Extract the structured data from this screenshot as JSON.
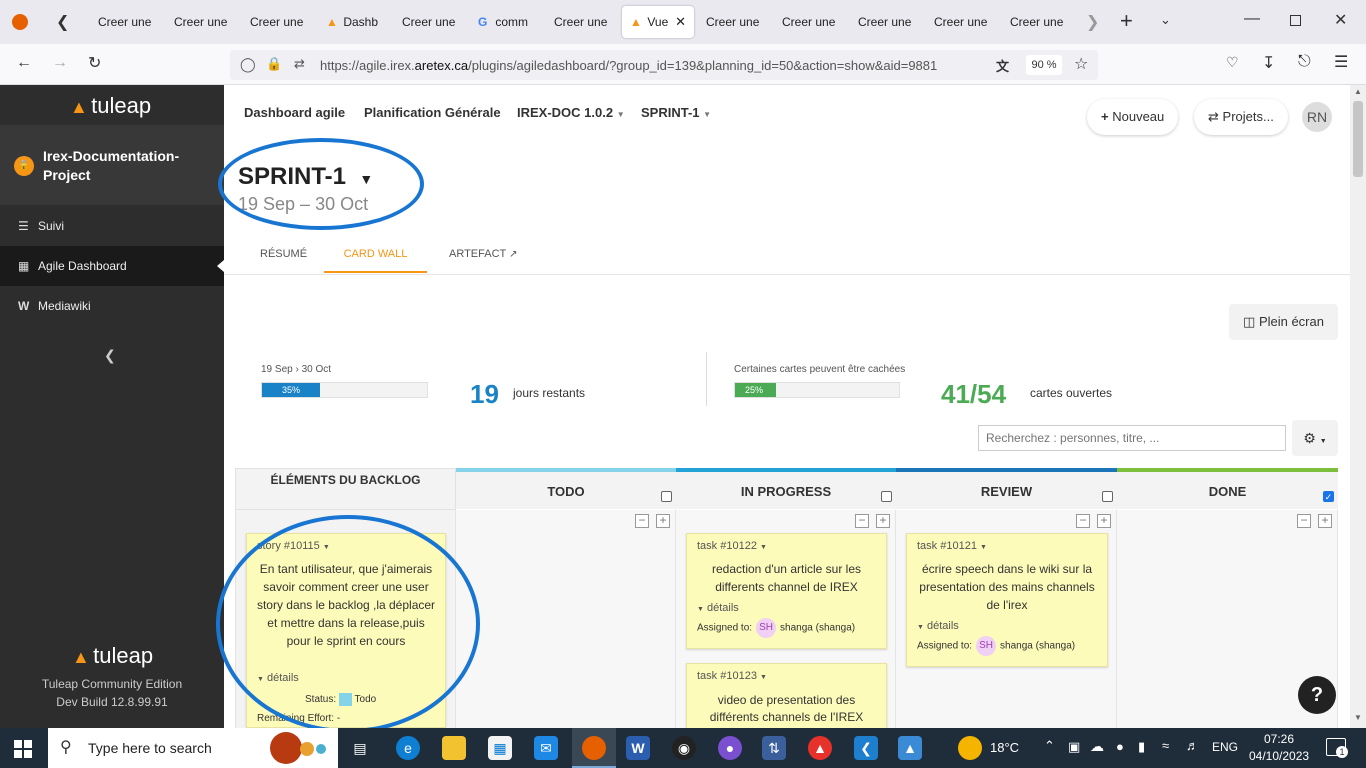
{
  "browser": {
    "tabs": [
      "Creer une",
      "Creer une",
      "Creer une",
      "Dashb",
      "Creer une",
      "comm",
      "Creer une",
      "Vue",
      "Creer une",
      "Creer une",
      "Creer une",
      "Creer une",
      "Creer une"
    ],
    "url_prefix": "https://agile.irex.",
    "url_domain": "aretex.ca",
    "url_rest": "/plugins/agiledashboard/?group_id=139&planning_id=50&action=show&aid=9881",
    "zoom": "90 %"
  },
  "sidebar": {
    "logo": "tuleap",
    "project": "Irex-Documentation-Project",
    "items": [
      {
        "label": "Suivi"
      },
      {
        "label": "Agile Dashboard"
      },
      {
        "label": "Mediawiki"
      }
    ],
    "footer_logo": "tuleap",
    "edition": "Tuleap Community Edition",
    "build": "Dev Build 12.8.99.91"
  },
  "breadcrumb": [
    "Dashboard agile",
    "Planification Générale",
    "IREX-DOC 1.0.2",
    "SPRINT-1"
  ],
  "header_buttons": {
    "new": "Nouveau",
    "projects": "Projets...",
    "avatar": "RN"
  },
  "sprint": {
    "title": "SPRINT-1",
    "dates": "19 Sep – 30 Oct"
  },
  "tabs": {
    "resume": "RÉSUMÉ",
    "cardwall": "CARD WALL",
    "artefact": "ARTEFACT"
  },
  "fullscreen": "Plein écran",
  "stats": {
    "date_from": "19 Sep",
    "date_to": "30 Oct",
    "time_progress": 35,
    "time_progress_label": "35%",
    "days_left": "19",
    "days_label": "jours restants",
    "hidden_note": "Certaines cartes peuvent être cachées",
    "cards_progress": 25,
    "cards_progress_label": "25%",
    "cards_open": "41/54",
    "cards_label": "cartes ouvertes"
  },
  "search": {
    "placeholder": "Recherchez : personnes, titre, ..."
  },
  "columns": {
    "backlog": "ÉLÉMENTS DU BACKLOG",
    "todo": "TODO",
    "inprogress": "IN PROGRESS",
    "review": "REVIEW",
    "done": "DONE"
  },
  "cards": {
    "story": {
      "id": "story #10115",
      "title": "En tant utilisateur, que j'aimerais savoir comment creer une user story dans le backlog ,la déplacer et mettre dans la release,puis pour le sprint en cours",
      "details": "détails",
      "status_label": "Status:",
      "status": "Todo",
      "effort": "Remaining Effort: -"
    },
    "task1": {
      "id": "task #10122",
      "title": "redaction d'un article sur les differents channel de IREX",
      "details": "détails",
      "assign_label": "Assigned to:",
      "avatar": "SH",
      "assignee": "shanga (shanga)"
    },
    "task2": {
      "id": "task #10123",
      "title": "video de presentation des différents channels de l'IREX"
    },
    "task3": {
      "id": "task #10121",
      "title": "écrire speech dans le wiki sur la presentation des mains channels de l'irex",
      "details": "détails",
      "assign_label": "Assigned to:",
      "avatar": "SH",
      "assignee": "shanga (shanga)"
    }
  },
  "help": "?",
  "taskbar": {
    "search_placeholder": "Type here to search",
    "temperature": "18°C",
    "lang": "ENG",
    "time": "07:26",
    "date": "04/10/2023",
    "notif_count": "1"
  },
  "colors": {
    "accent_orange": "#f79514",
    "progress_blue": "#1a83c8",
    "progress_green": "#4aab54",
    "todo_bar": "#85d3e8",
    "inprogress_bar": "#22a3d6",
    "review_bar": "#1b75b8",
    "done_bar": "#7bbf3b",
    "highlight": "#1876d2"
  }
}
